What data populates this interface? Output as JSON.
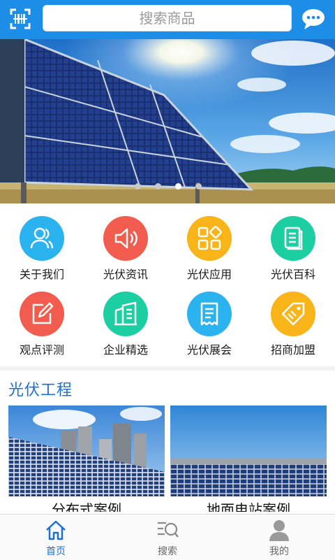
{
  "header": {
    "search_placeholder": "搜索商品",
    "scan_icon": "scan-icon",
    "message_icon": "chat-bubble-icon",
    "color": "#1d8ee8"
  },
  "banner": {
    "slides": 4,
    "active_slide": 3
  },
  "menu": [
    {
      "label": "关于我们",
      "icon": "people-icon",
      "color": "#2bb3f0"
    },
    {
      "label": "光伏资讯",
      "icon": "speaker-icon",
      "color": "#f15c4e"
    },
    {
      "label": "光伏应用",
      "icon": "apps-grid-icon",
      "color": "#f8b418"
    },
    {
      "label": "光伏百科",
      "icon": "document-icon",
      "color": "#1ccfa3"
    },
    {
      "label": "观点评测",
      "icon": "edit-icon",
      "color": "#f15c4e"
    },
    {
      "label": "企业精选",
      "icon": "building-icon",
      "color": "#1ccfa3"
    },
    {
      "label": "光伏展会",
      "icon": "receipt-icon",
      "color": "#2bb3f0"
    },
    {
      "label": "招商加盟",
      "icon": "tag-icon",
      "color": "#f8b418"
    }
  ],
  "section": {
    "title": "光伏工程",
    "cards": [
      {
        "label": "分布式案例"
      },
      {
        "label": "地面电站案例"
      }
    ]
  },
  "tabbar": [
    {
      "label": "首页",
      "icon": "home-icon",
      "active": true
    },
    {
      "label": "搜索",
      "icon": "search-icon",
      "active": false
    },
    {
      "label": "我的",
      "icon": "person-icon",
      "active": false
    }
  ]
}
